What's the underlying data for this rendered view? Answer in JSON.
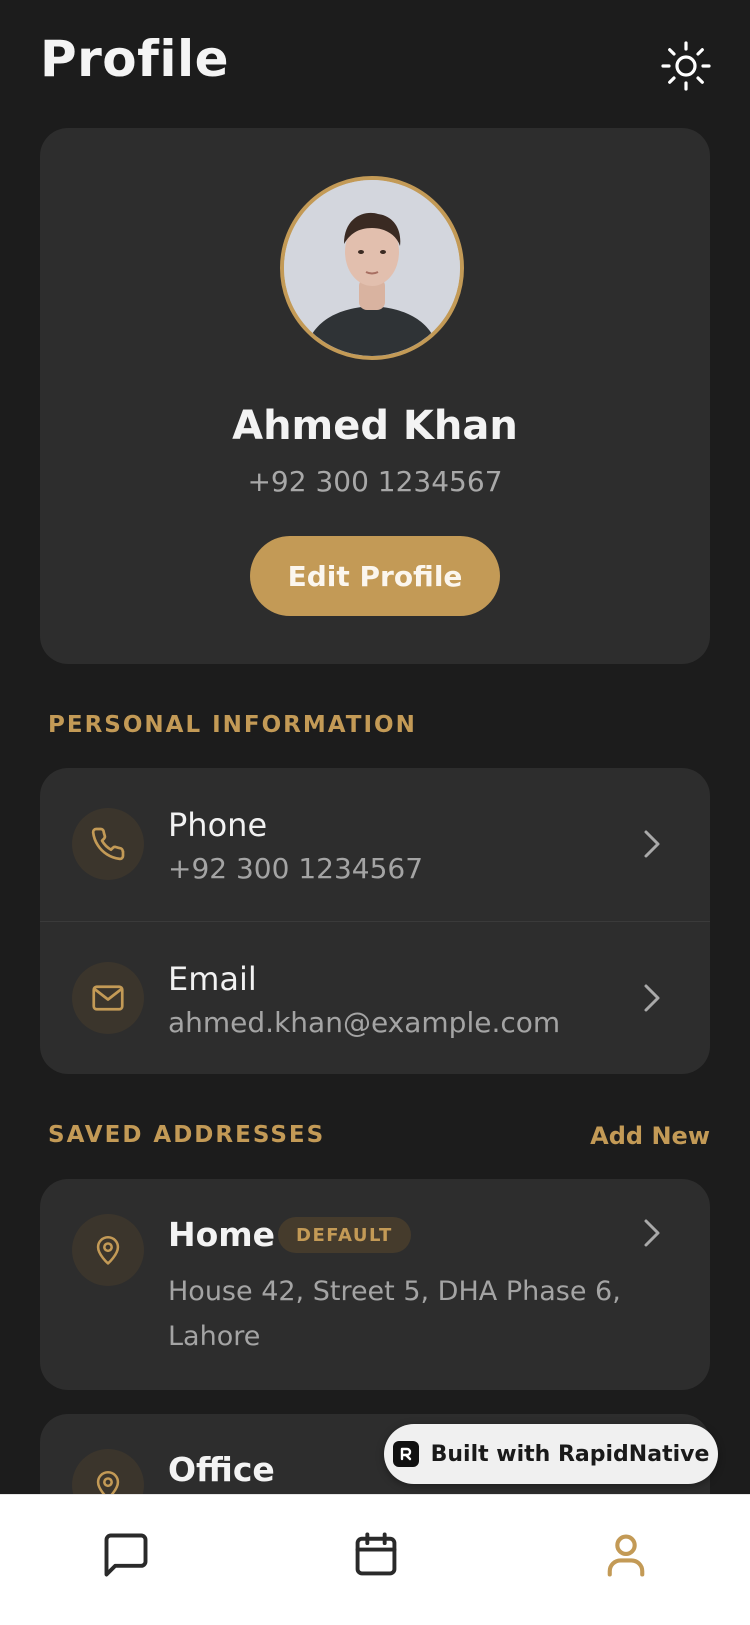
{
  "header": {
    "title": "Profile",
    "theme_icon": "sun-icon"
  },
  "profile": {
    "name": "Ahmed Khan",
    "phone": "+92 300 1234567",
    "edit_label": "Edit Profile"
  },
  "personal_info": {
    "section_title": "PERSONAL INFORMATION",
    "items": [
      {
        "label": "Phone",
        "value": "+92 300 1234567",
        "icon": "phone-icon"
      },
      {
        "label": "Email",
        "value": "ahmed.khan@example.com",
        "icon": "mail-icon"
      }
    ]
  },
  "addresses": {
    "section_title": "SAVED ADDRESSES",
    "add_label": "Add New",
    "items": [
      {
        "label": "Home",
        "badge": "DEFAULT",
        "text": "House 42, Street 5, DHA Phase 6, Lahore",
        "icon": "location-pin-icon"
      },
      {
        "label": "Office",
        "icon": "location-pin-icon"
      }
    ]
  },
  "watermark": {
    "label": "Built with RapidNative"
  },
  "tabbar": {
    "tabs": [
      {
        "icon": "chat-icon",
        "active": false
      },
      {
        "icon": "calendar-icon",
        "active": false
      },
      {
        "icon": "user-icon",
        "active": true
      }
    ]
  },
  "colors": {
    "accent": "#c39a56",
    "background": "#1c1c1c",
    "card": "#2d2d2d",
    "tab_inactive": "#2a2a2a"
  }
}
